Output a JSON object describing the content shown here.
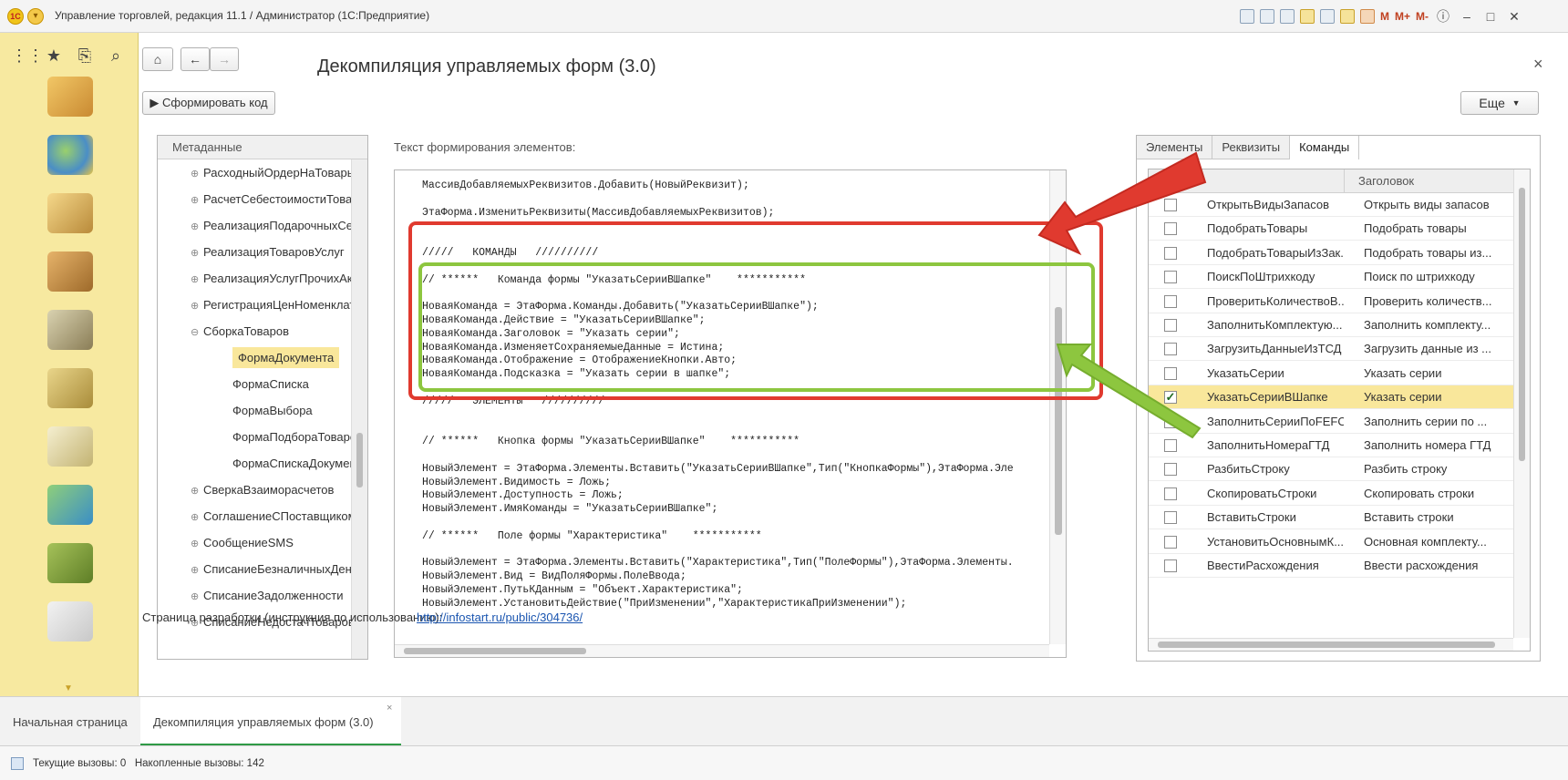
{
  "window": {
    "title": "Управление торговлей, редакция 11.1 / Администратор  (1С:Предприятие)",
    "logo_text": "1С",
    "m_buttons": [
      "M",
      "M+",
      "M-"
    ]
  },
  "form": {
    "title": "Декомпиляция управляемых форм (3.0)",
    "generate_button": "▶ Сформировать код",
    "more_button": "Еще",
    "close": "×",
    "code_label": "Текст формирования элементов:",
    "link_label": "Страница разработки (инструкция по использованию):",
    "link_url": "http://infostart.ru/public/304736/"
  },
  "metadata": {
    "header": "Метаданные",
    "rows": [
      {
        "label": "РасходныйОрдерНаТовары",
        "level": 1,
        "toggle": "⊕"
      },
      {
        "label": "РасчетСебестоимостиТоваров",
        "level": 1,
        "toggle": "⊕"
      },
      {
        "label": "РеализацияПодарочныхСерти",
        "level": 1,
        "toggle": "⊕"
      },
      {
        "label": "РеализацияТоваровУслуг",
        "level": 1,
        "toggle": "⊕"
      },
      {
        "label": "РеализацияУслугПрочихАктив",
        "level": 1,
        "toggle": "⊕"
      },
      {
        "label": "РегистрацияЦенНоменклатур",
        "level": 1,
        "toggle": "⊕"
      },
      {
        "label": "СборкаТоваров",
        "level": 1,
        "toggle": "⊖"
      },
      {
        "label": "ФормаДокумента",
        "level": 2,
        "toggle": "",
        "selected": true
      },
      {
        "label": "ФормаСписка",
        "level": 2,
        "toggle": ""
      },
      {
        "label": "ФормаВыбора",
        "level": 2,
        "toggle": ""
      },
      {
        "label": "ФормаПодбораТоваровИзЗ",
        "level": 2,
        "toggle": ""
      },
      {
        "label": "ФормаСпискаДокументов",
        "level": 2,
        "toggle": ""
      },
      {
        "label": "СверкаВзаиморасчетов",
        "level": 1,
        "toggle": "⊕"
      },
      {
        "label": "СоглашениеСПоставщиком",
        "level": 1,
        "toggle": "⊕"
      },
      {
        "label": "СообщениеSMS",
        "level": 1,
        "toggle": "⊕"
      },
      {
        "label": "СписаниеБезналичныхДенеж",
        "level": 1,
        "toggle": "⊕"
      },
      {
        "label": "СписаниеЗадолженности",
        "level": 1,
        "toggle": "⊕"
      },
      {
        "label": "СписаниеНедостачТоваров",
        "level": 1,
        "toggle": "⊕"
      }
    ]
  },
  "code_lines": [
    "МассивДобавляемыхРеквизитов.Добавить(НовыйРеквизит);",
    "",
    "ЭтаФорма.ИзменитьРеквизиты(МассивДобавляемыхРеквизитов);",
    "",
    "",
    "/////   КОМАНДЫ   //////////",
    "",
    "// ******   Команда формы \"УказатьСерииВШапке\"    ***********",
    "",
    "НоваяКоманда = ЭтаФорма.Команды.Добавить(\"УказатьСерииВШапке\");",
    "НоваяКоманда.Действие = \"УказатьСерииВШапке\";",
    "НоваяКоманда.Заголовок = \"Указать серии\";",
    "НоваяКоманда.ИзменяетСохраняемыеДанные = Истина;",
    "НоваяКоманда.Отображение = ОтображениеКнопки.Авто;",
    "НоваяКоманда.Подсказка = \"Указать серии в шапке\";",
    "",
    "/////   ЭЛЕМЕНТЫ   //////////",
    "",
    "",
    "// ******   Кнопка формы \"УказатьСерииВШапке\"    ***********",
    "",
    "НовыйЭлемент = ЭтаФорма.Элементы.Вставить(\"УказатьСерииВШапке\",Тип(\"КнопкаФормы\"),ЭтаФорма.Эле",
    "НовыйЭлемент.Видимость = Ложь;",
    "НовыйЭлемент.Доступность = Ложь;",
    "НовыйЭлемент.ИмяКоманды = \"УказатьСерииВШапке\";",
    "",
    "// ******   Поле формы \"Характеристика\"    ***********",
    "",
    "НовыйЭлемент = ЭтаФорма.Элементы.Вставить(\"Характеристика\",Тип(\"ПолеФормы\"),ЭтаФорма.Элементы.",
    "НовыйЭлемент.Вид = ВидПоляФормы.ПолеВвода;",
    "НовыйЭлемент.ПутьКДанным = \"Объект.Характеристика\";",
    "НовыйЭлемент.УстановитьДействие(\"ПриИзменении\",\"ХарактеристикаПриИзменении\");"
  ],
  "right_panel": {
    "tabs": [
      {
        "label": "Элементы",
        "active": false
      },
      {
        "label": "Реквизиты",
        "active": false
      },
      {
        "label": "Команды",
        "active": true
      }
    ],
    "header_title": "Заголовок",
    "rows": [
      {
        "name": "ОткрытьВидыЗапасов",
        "title": "Открыть виды запасов",
        "checked": false
      },
      {
        "name": "ПодобратьТовары",
        "title": "Подобрать товары",
        "checked": false
      },
      {
        "name": "ПодобратьТоварыИзЗак...",
        "title": "Подобрать товары из...",
        "checked": false
      },
      {
        "name": "ПоискПоШтрихкоду",
        "title": "Поиск по штрихкоду",
        "checked": false
      },
      {
        "name": "ПроверитьКоличествоВ...",
        "title": "Проверить количеств...",
        "checked": false
      },
      {
        "name": "ЗаполнитьКомплектую...",
        "title": "Заполнить комплекту...",
        "checked": false
      },
      {
        "name": "ЗагрузитьДанныеИзТСД",
        "title": "Загрузить данные из ...",
        "checked": false
      },
      {
        "name": "УказатьСерии",
        "title": "Указать серии",
        "checked": false
      },
      {
        "name": "УказатьСерииВШапке",
        "title": "Указать серии",
        "checked": true,
        "selected": true
      },
      {
        "name": "ЗаполнитьСерииПоFEFO",
        "title": "Заполнить серии по ...",
        "checked": false
      },
      {
        "name": "ЗаполнитьНомераГТД",
        "title": "Заполнить номера ГТД",
        "checked": false
      },
      {
        "name": "РазбитьСтроку",
        "title": "Разбить строку",
        "checked": false
      },
      {
        "name": "СкопироватьСтроки",
        "title": "Скопировать строки",
        "checked": false
      },
      {
        "name": "ВставитьСтроки",
        "title": "Вставить строки",
        "checked": false
      },
      {
        "name": "УстановитьОсновнымК...",
        "title": "Основная комплекту...",
        "checked": false
      },
      {
        "name": "ВвестиРасхождения",
        "title": "Ввести расхождения",
        "checked": false
      }
    ]
  },
  "bottom_tabs": [
    {
      "label": "Начальная страница",
      "active": false
    },
    {
      "label": "Декомпиляция управляемых форм (3.0)",
      "active": true
    }
  ],
  "status": {
    "current_calls": "Текущие вызовы: 0",
    "accumulated_calls": "Накопленные вызовы: 142"
  },
  "colors": {
    "sidebar": "#f7e9a0",
    "selection": "#f9e79b",
    "red_highlight": "#e03a2f",
    "green_highlight": "#8dc63f"
  }
}
